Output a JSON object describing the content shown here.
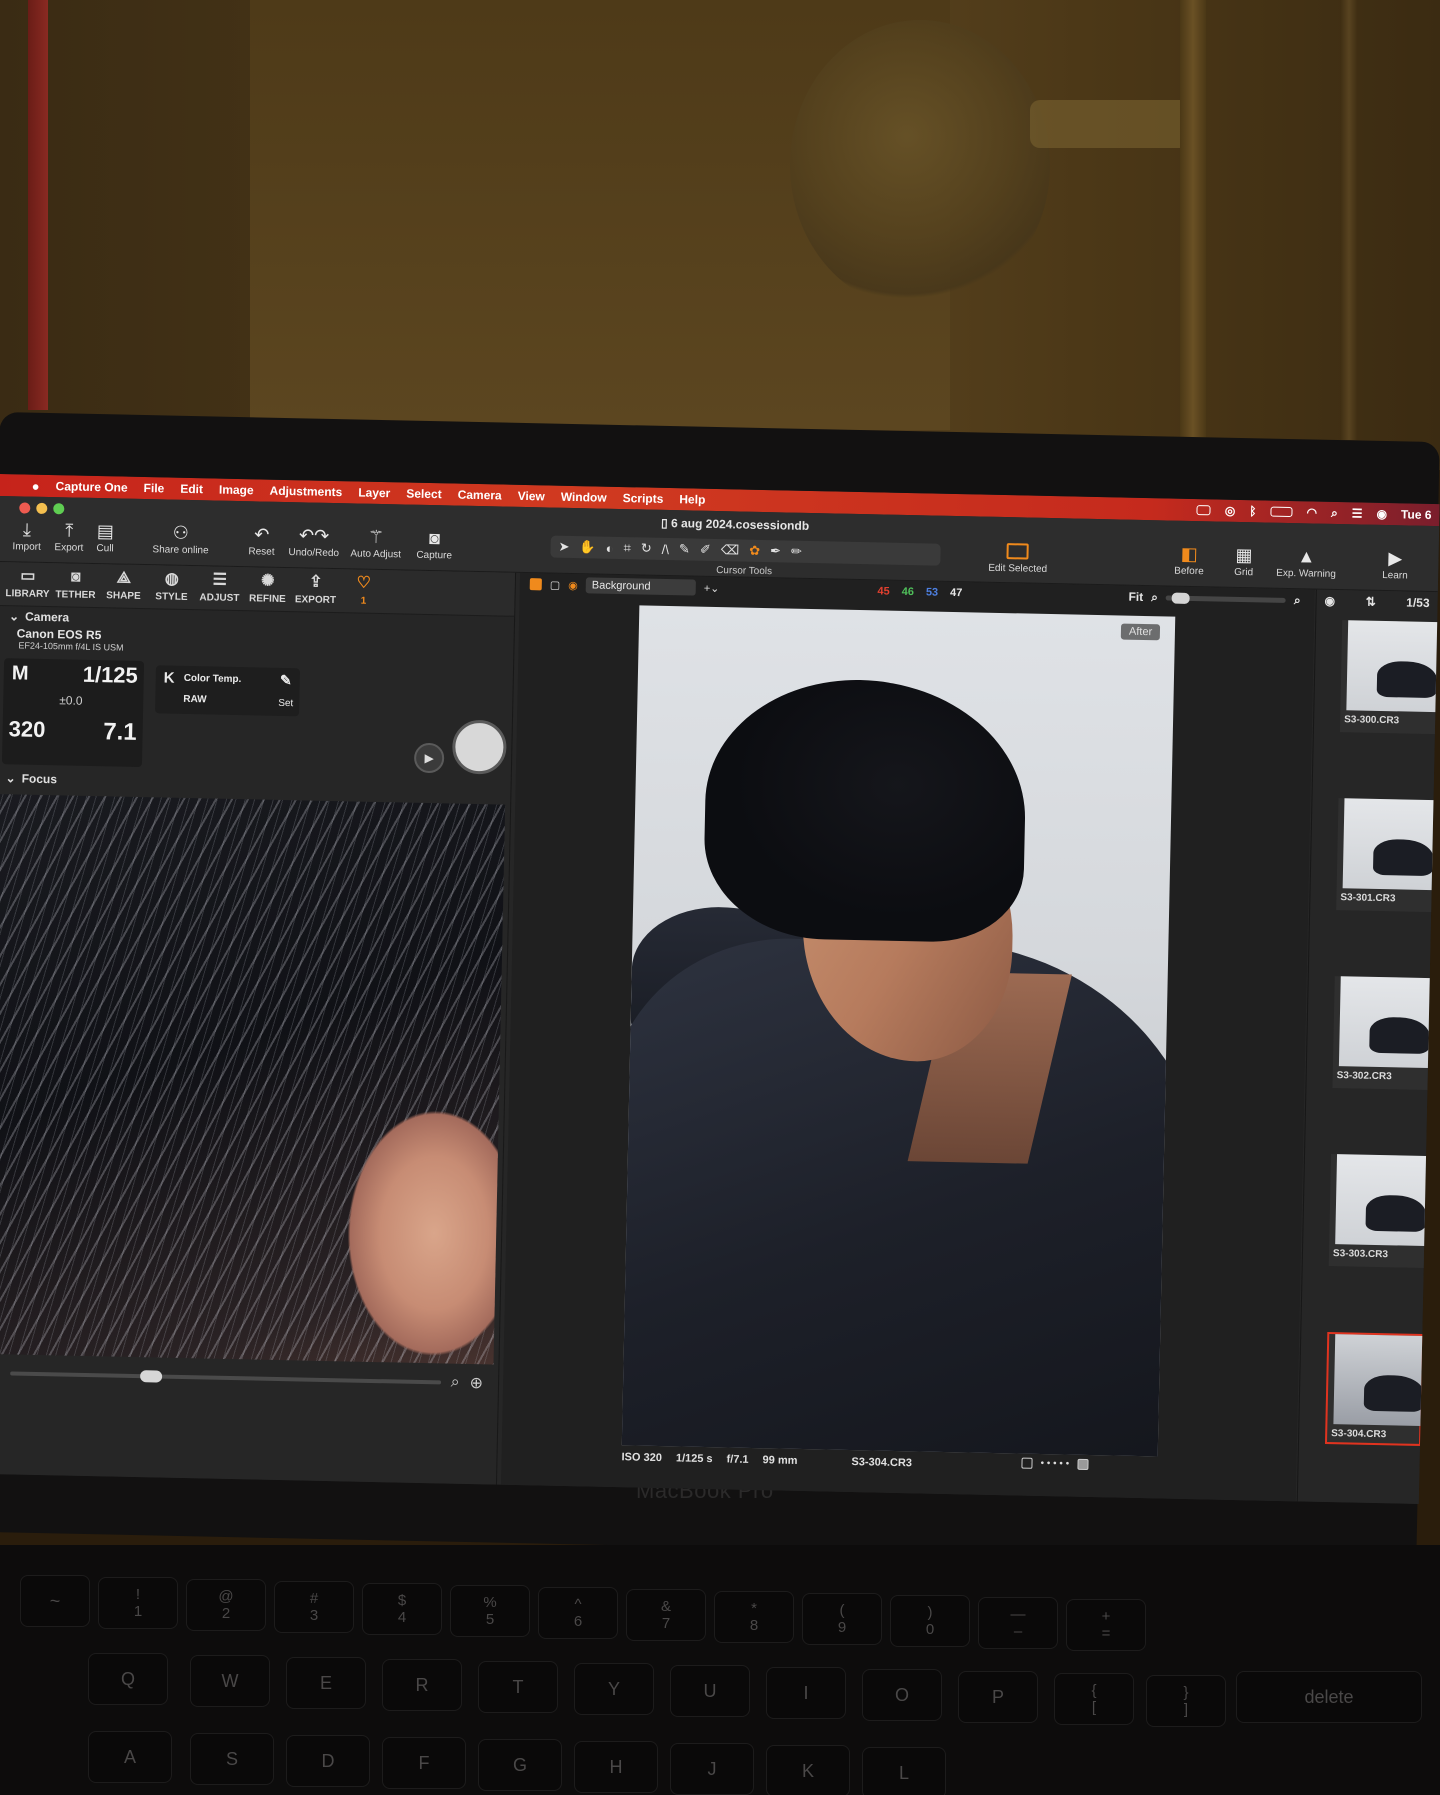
{
  "menubar": {
    "apple": "",
    "items": [
      "Capture One",
      "File",
      "Edit",
      "Image",
      "Adjustments",
      "Layer",
      "Select",
      "Camera",
      "View",
      "Window",
      "Scripts",
      "Help"
    ],
    "clock": "Tue 6"
  },
  "window": {
    "title": "6 aug 2024.cosessiondb"
  },
  "toolbar": {
    "import": "Import",
    "export": "Export",
    "cull": "Cull",
    "share_online": "Share online",
    "reset": "Reset",
    "undo_redo": "Undo/Redo",
    "auto_adjust": "Auto Adjust",
    "capture": "Capture",
    "cursor_tools": "Cursor Tools",
    "edit_selected": "Edit Selected",
    "before": "Before",
    "grid": "Grid",
    "exp_warning": "Exp. Warning",
    "learn": "Learn"
  },
  "tool_tabs": [
    "LIBRARY",
    "TETHER",
    "SHAPE",
    "STYLE",
    "ADJUST",
    "REFINE",
    "EXPORT"
  ],
  "favorites_count": "1",
  "camera": {
    "section": "Camera",
    "model": "Canon EOS R5",
    "lens": "EF24-105mm f/4L IS USM",
    "mode": "M",
    "shutter": "1/125",
    "ev": "±0.0",
    "iso": "320",
    "aperture": "7.1",
    "wb_k": "K",
    "color_temp": "Color Temp.",
    "raw": "RAW",
    "set": "Set"
  },
  "focus": {
    "section": "Focus"
  },
  "viewer": {
    "background_select": "Background",
    "counts": [
      {
        "value": "45",
        "color": "#e2402f"
      },
      {
        "value": "46",
        "color": "#4fbf5a"
      },
      {
        "value": "53",
        "color": "#4d7fe0"
      },
      {
        "value": "47",
        "color": "#e6e6e6"
      }
    ],
    "fit": "Fit",
    "after_badge": "After",
    "meta": {
      "iso": "ISO 320",
      "shutter": "1/125 s",
      "aperture": "f/7.1",
      "focal": "99 mm",
      "filename": "S3-304.CR3"
    }
  },
  "browser": {
    "count": "1/53",
    "thumbnails": [
      {
        "label": "S3-300.CR3",
        "selected": false
      },
      {
        "label": "S3-301.CR3",
        "selected": false
      },
      {
        "label": "S3-302.CR3",
        "selected": false
      },
      {
        "label": "S3-303.CR3",
        "selected": false
      },
      {
        "label": "S3-304.CR3",
        "selected": true
      }
    ]
  },
  "device": {
    "label": "MacBook Pro"
  },
  "keyboard": {
    "row1": [
      "!\n1",
      "@\n2",
      "#\n3",
      "$\n4",
      "%\n5",
      "^\n6",
      "&\n7",
      "*\n8",
      "(\n9",
      ")\n0",
      "—\n–",
      "+\n="
    ],
    "row2": [
      "Q",
      "W",
      "E",
      "R",
      "T",
      "Y",
      "U",
      "I",
      "O",
      "P",
      "{\n[",
      "}\n]"
    ],
    "row3": [
      "A",
      "S",
      "D",
      "F",
      "G",
      "H",
      "J",
      "K",
      "L"
    ],
    "delete": "delete"
  }
}
